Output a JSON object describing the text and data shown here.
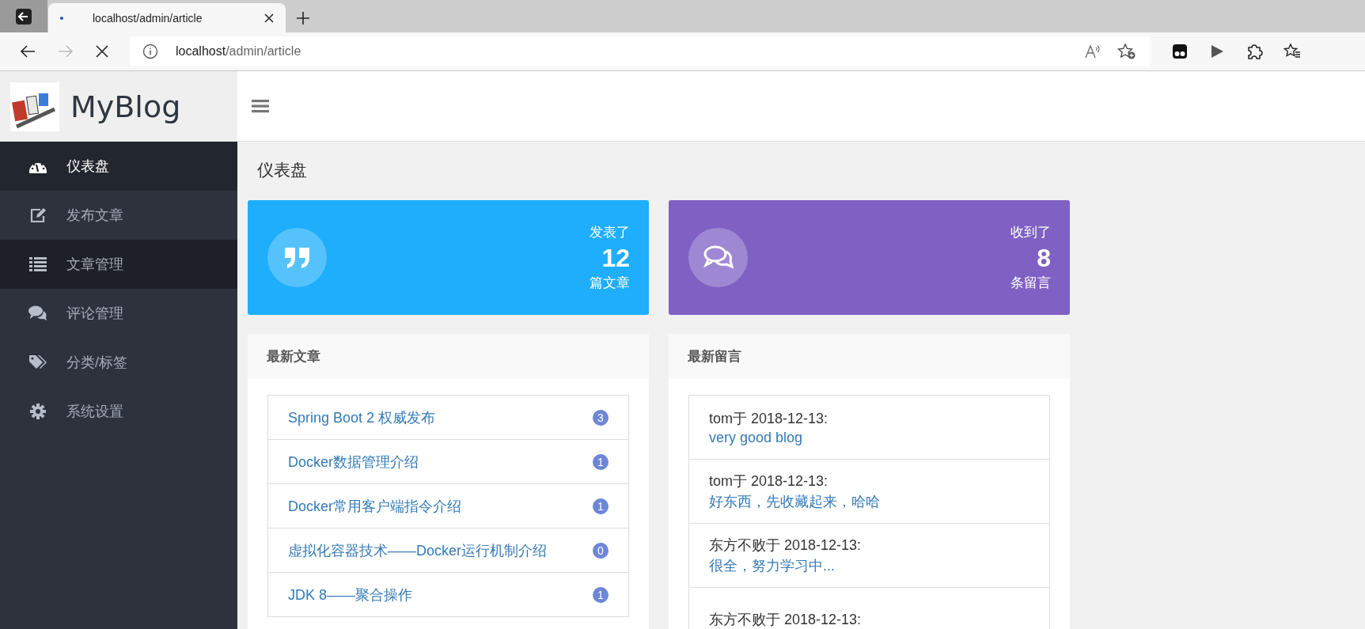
{
  "browser": {
    "tab_title": "localhost/admin/article",
    "address_host": "localhost",
    "address_path": "/admin/article"
  },
  "brand": {
    "name": "MyBlog"
  },
  "sidebar": {
    "items": [
      {
        "label": "仪表盘",
        "kind": "dashboard",
        "selected": true,
        "hovered": false
      },
      {
        "label": "发布文章",
        "kind": "edit",
        "selected": false,
        "hovered": false
      },
      {
        "label": "文章管理",
        "kind": "list",
        "selected": false,
        "hovered": true
      },
      {
        "label": "评论管理",
        "kind": "comments",
        "selected": false,
        "hovered": false
      },
      {
        "label": "分类/标签",
        "kind": "tags",
        "selected": false,
        "hovered": false
      },
      {
        "label": "系统设置",
        "kind": "gear",
        "selected": false,
        "hovered": false
      }
    ]
  },
  "page_title": "仪表盘",
  "stats": [
    {
      "kind": "quote",
      "top": "发表了",
      "value": "12",
      "bottom": "篇文章",
      "color": "#1eaefc"
    },
    {
      "kind": "comments",
      "top": "收到了",
      "value": "8",
      "bottom": "条留言",
      "color": "#7f61c4"
    }
  ],
  "latest_articles": {
    "title": "最新文章",
    "items": [
      {
        "title": "Spring Boot 2 权威发布",
        "count": "3"
      },
      {
        "title": "Docker数据管理介绍",
        "count": "1"
      },
      {
        "title": "Docker常用客户端指令介绍",
        "count": "1"
      },
      {
        "title": "虚拟化容器技术——Docker运行机制介绍",
        "count": "0"
      },
      {
        "title": "JDK 8——聚合操作",
        "count": "1"
      }
    ]
  },
  "latest_comments": {
    "title": "最新留言",
    "items": [
      {
        "author": "tom于 2018-12-13:",
        "text": "very good blog"
      },
      {
        "author": "tom于 2018-12-13:",
        "text": "好东西，先收藏起来，哈哈"
      },
      {
        "author": "东方不败于 2018-12-13:",
        "text": "很全，努力学习中..."
      },
      {
        "author": "东方不败于 2018-12-13:"
      }
    ]
  }
}
